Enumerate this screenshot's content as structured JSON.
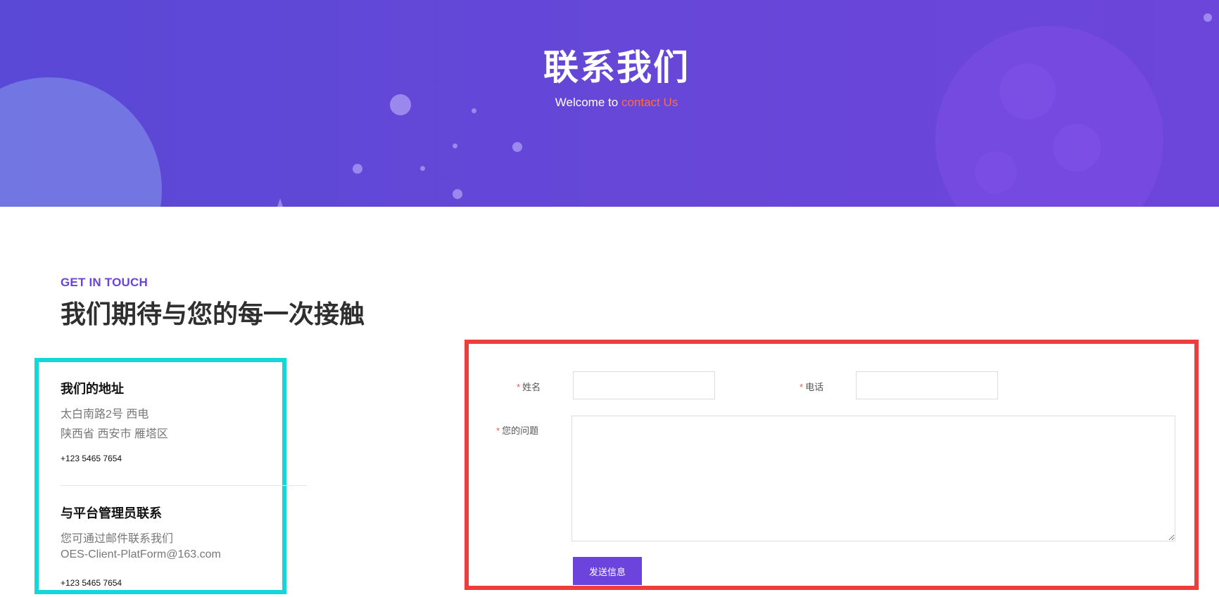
{
  "hero": {
    "title": "联系我们",
    "subtitle_prefix": "Welcome to",
    "subtitle_accent": "contact Us"
  },
  "section": {
    "kicker": "GET IN TOUCH",
    "title": "我们期待与您的每一次接触"
  },
  "address": {
    "title": "我们的地址",
    "line1": "太白南路2号 西电",
    "line2": "陕西省 西安市 雁塔区",
    "phone": "+123 5465 7654"
  },
  "admin": {
    "title": "与平台管理员联系",
    "line1": "您可通过邮件联系我们",
    "line2": "OES-Client-PlatForm@163.com",
    "phone": "+123 5465 7654"
  },
  "form": {
    "name_label": "姓名",
    "phone_label": "电话",
    "question_label": "您的问题",
    "required_mark": "*",
    "name_value": "",
    "phone_value": "",
    "question_value": "",
    "submit_label": "发送信息"
  },
  "colors": {
    "hero": "#5a48d6",
    "accent": "#ff6b4a",
    "kicker": "#6a44d8",
    "info_highlight": "#14d8d8",
    "form_highlight": "#f03c3c",
    "button": "#6c44dd"
  }
}
